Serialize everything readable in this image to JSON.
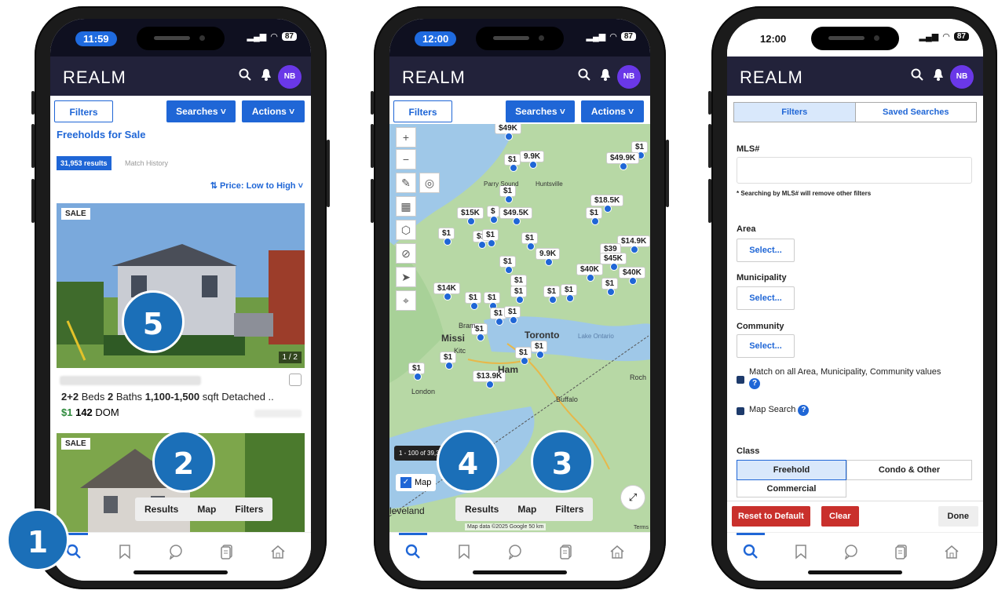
{
  "phone1": {
    "time": "11:59",
    "battery": "87",
    "logo": "REALM",
    "avatar": "NB",
    "filters_label": "Filters",
    "searches_label": "Searches ˅",
    "actions_label": "Actions ˅",
    "heading": "Freeholds for Sale",
    "results_badge": "31,953 results",
    "match_history": "Match History",
    "sort_label": "⇅  Price: Low to High ˅",
    "listing1": {
      "badge": "SALE",
      "photo_count": "1 / 2",
      "details_a": "2+2",
      "details_b": "Beds",
      "details_c": "2",
      "details_d": "Baths",
      "details_e": "1,100-1,500",
      "details_f": "sqft Detached ..",
      "price": "$1",
      "dom_num": "142",
      "dom_label": "DOM"
    },
    "listing2": {
      "badge": "SALE"
    },
    "seg": {
      "results": "Results",
      "map": "Map",
      "filters": "Filters"
    },
    "callouts": {
      "c1": "1",
      "c2": "2",
      "c5": "5"
    }
  },
  "phone2": {
    "time": "12:00",
    "battery": "87",
    "logo": "REALM",
    "avatar": "NB",
    "filters_label": "Filters",
    "searches_label": "Searches ˅",
    "actions_label": "Actions ˅",
    "map_pins": [
      "$49K",
      "$1",
      "9.9K",
      "$1",
      "$49.9K",
      "$1",
      "$18.5K",
      "$1",
      "$15K",
      "$",
      "$49.5K",
      "$1",
      "$1",
      "$1",
      "$1",
      "$14.9K",
      "$39",
      "$45K",
      "$1",
      "9.9K",
      "$40K",
      "$40K",
      "$1",
      "$14K",
      "$1",
      "$1",
      "$1",
      "$1",
      "$1",
      "$1",
      "$1",
      "$1",
      "$1",
      "$1",
      "$1",
      "$13.9K",
      "$1",
      "$1"
    ],
    "map_labels": {
      "parry_sound": "Parry Sound",
      "huntsville": "Huntsville",
      "toronto": "Toronto",
      "missi": "Missi",
      "kitc": "Kitc",
      "ham": "Ham",
      "bram": "Bram",
      "london": "London",
      "buffalo": "Buffalo",
      "lake_ontario": "Lake Ontario",
      "cleveland": "leveland",
      "roch": "Roch"
    },
    "map_count": "1 - 100 of 39,3...",
    "map_checkbox": "Map",
    "attribution": "Map data ©2025 Google   50 km",
    "terms": "Terms",
    "seg": {
      "results": "Results",
      "map": "Map",
      "filters": "Filters"
    },
    "callouts": {
      "c3": "3",
      "c4": "4"
    }
  },
  "phone3": {
    "time": "12:00",
    "battery": "87",
    "logo": "REALM",
    "avatar": "NB",
    "tab_filters": "Filters",
    "tab_saved": "Saved Searches",
    "mls_label": "MLS#",
    "mls_note": "* Searching by MLS# will remove other filters",
    "area_label": "Area",
    "municipality_label": "Municipality",
    "community_label": "Community",
    "select": "Select...",
    "match_all": "Match on all Area, Municipality, Community values",
    "map_search": "Map Search",
    "class_label": "Class",
    "class_freehold": "Freehold",
    "class_condo": "Condo & Other",
    "class_commercial": "Commercial",
    "reset": "Reset to Default",
    "clear": "Clear",
    "done": "Done"
  },
  "colors": {
    "accent": "#1f66d6",
    "appbar": "#22223a",
    "callout": "#1b6fb8",
    "danger": "#c9302c"
  }
}
